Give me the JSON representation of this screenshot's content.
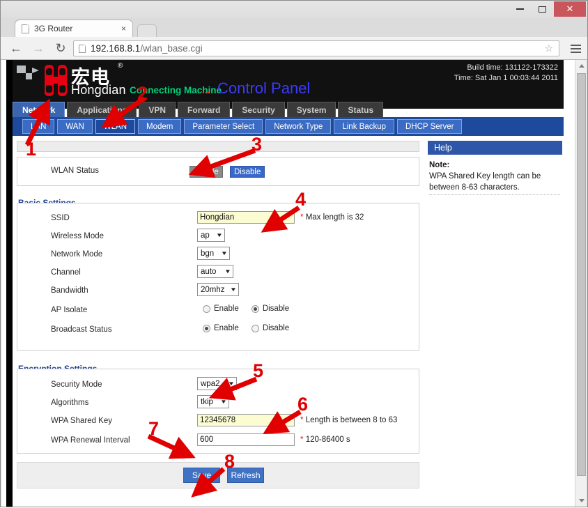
{
  "browser": {
    "tab_title": "3G Router",
    "tab_close": "×",
    "url_host": "192.168.8.1",
    "url_path": "/wlan_base.cgi",
    "star_icon": "☆",
    "back_icon": "←",
    "forward_icon": "→",
    "reload_icon": "↻",
    "minimize": "",
    "maximize": "",
    "close": "✕"
  },
  "header": {
    "logo_cn": "宏电",
    "logo_reg": "®",
    "logo_en": "Hongdian",
    "connecting": "Connecting Machine",
    "connecting_dots": "...",
    "control_panel": "Control Panel",
    "build_time": "Build time: 131122-173322",
    "time": "Time: Sat Jan 1 00:03:44 2011"
  },
  "main_tabs": [
    {
      "label": "Network",
      "active": true
    },
    {
      "label": "Applications",
      "active": false
    },
    {
      "label": "VPN",
      "active": false
    },
    {
      "label": "Forward",
      "active": false
    },
    {
      "label": "Security",
      "active": false
    },
    {
      "label": "System",
      "active": false
    },
    {
      "label": "Status",
      "active": false
    }
  ],
  "sub_tabs": [
    {
      "label": "LAN",
      "active": false
    },
    {
      "label": "WAN",
      "active": false
    },
    {
      "label": "WLAN",
      "active": true
    },
    {
      "label": "Modem",
      "active": false
    },
    {
      "label": "Parameter Select",
      "active": false
    },
    {
      "label": "Network Type",
      "active": false
    },
    {
      "label": "Link Backup",
      "active": false
    },
    {
      "label": "DHCP Server",
      "active": false
    }
  ],
  "wlan_status": {
    "label": "WLAN Status",
    "enable_label": "Enable",
    "disable_label": "Disable",
    "selected": "Enable"
  },
  "basic_settings": {
    "legend": "Basic Settings",
    "ssid": {
      "label": "SSID",
      "value": "Hongdian",
      "hint_star": "*",
      "hint": "Max length is 32"
    },
    "wireless_mode": {
      "label": "Wireless Mode",
      "value": "ap"
    },
    "network_mode": {
      "label": "Network Mode",
      "value": "bgn"
    },
    "channel": {
      "label": "Channel",
      "value": "auto"
    },
    "bandwidth": {
      "label": "Bandwidth",
      "value": "20mhz"
    },
    "ap_isolate": {
      "label": "AP Isolate",
      "enable": "Enable",
      "disable": "Disable",
      "selected": "Disable"
    },
    "broadcast_status": {
      "label": "Broadcast Status",
      "enable": "Enable",
      "disable": "Disable",
      "selected": "Enable"
    }
  },
  "encryption_settings": {
    "legend": "Encryption Settings",
    "security_mode": {
      "label": "Security Mode",
      "value": "wpa2"
    },
    "algorithms": {
      "label": "Algorithms",
      "value": "tkip"
    },
    "wpa_shared_key": {
      "label": "WPA Shared Key",
      "value": "12345678",
      "hint_star": "*",
      "hint": "Length is between 8 to 63"
    },
    "wpa_renewal_interval": {
      "label": "WPA Renewal Interval",
      "value": "600",
      "hint_star": "*",
      "hint": "120-86400 s"
    }
  },
  "actions": {
    "save": "Save",
    "refresh": "Refresh"
  },
  "help": {
    "title": "Help",
    "note_label": "Note:",
    "note_text": "WPA Shared Key length can be between 8-63 characters."
  },
  "annotations": [
    {
      "number": "1"
    },
    {
      "number": "2"
    },
    {
      "number": "3"
    },
    {
      "number": "4"
    },
    {
      "number": "5"
    },
    {
      "number": "6"
    },
    {
      "number": "7"
    },
    {
      "number": "8"
    }
  ],
  "colors": {
    "annotation_red": "#e00000",
    "tab_active_blue": "#3a66b0",
    "subnav_blue": "#1e4a9e",
    "highlight_yellow": "#fcfcd2",
    "header_black": "#111111",
    "logo_red": "#e60012",
    "connecting_green": "#00d07a",
    "control_panel_blue": "#3b3bff",
    "button_blue": "#4072c4"
  }
}
